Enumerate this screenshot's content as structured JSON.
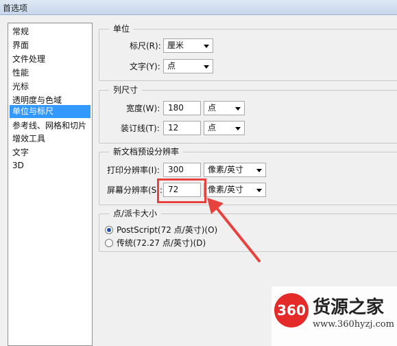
{
  "window": {
    "title": "首选项"
  },
  "sidebar": {
    "items": [
      {
        "label": "常规"
      },
      {
        "label": "界面"
      },
      {
        "label": "文件处理"
      },
      {
        "label": "性能"
      },
      {
        "label": "光标"
      },
      {
        "label": "透明度与色域"
      },
      {
        "label": "单位与标尺",
        "selected": true
      },
      {
        "label": "参考线、网格和切片"
      },
      {
        "label": "增效工具"
      },
      {
        "label": "文字"
      },
      {
        "label": "3D"
      }
    ]
  },
  "units": {
    "legend": "单位",
    "ruler_label": "标尺(R):",
    "ruler_value": "厘米",
    "type_label": "文字(Y):",
    "type_value": "点"
  },
  "column_size": {
    "legend": "列尺寸",
    "width_label": "宽度(W):",
    "width_value": "180",
    "width_unit": "点",
    "gutter_label": "装订线(T):",
    "gutter_value": "12",
    "gutter_unit": "点"
  },
  "resolution": {
    "legend": "新文档预设分辨率",
    "print_label": "打印分辨率(I):",
    "print_value": "300",
    "print_unit": "像素/英寸",
    "screen_label": "屏幕分辨率(S):",
    "screen_value": "72",
    "screen_unit": "像素/英寸"
  },
  "point_size": {
    "legend": "点/派卡大小",
    "option1": "PostScript(72 点/英寸)(O)",
    "option2": "传统(72.27 点/英寸)(D)",
    "selected": "option1"
  },
  "watermark": {
    "logo_text": "360",
    "brand": "货源之家",
    "site": "www.360hyzj.com"
  },
  "colors": {
    "selection": "#3399ff",
    "highlight": "#e8423f",
    "logo": "#e52a2a"
  }
}
